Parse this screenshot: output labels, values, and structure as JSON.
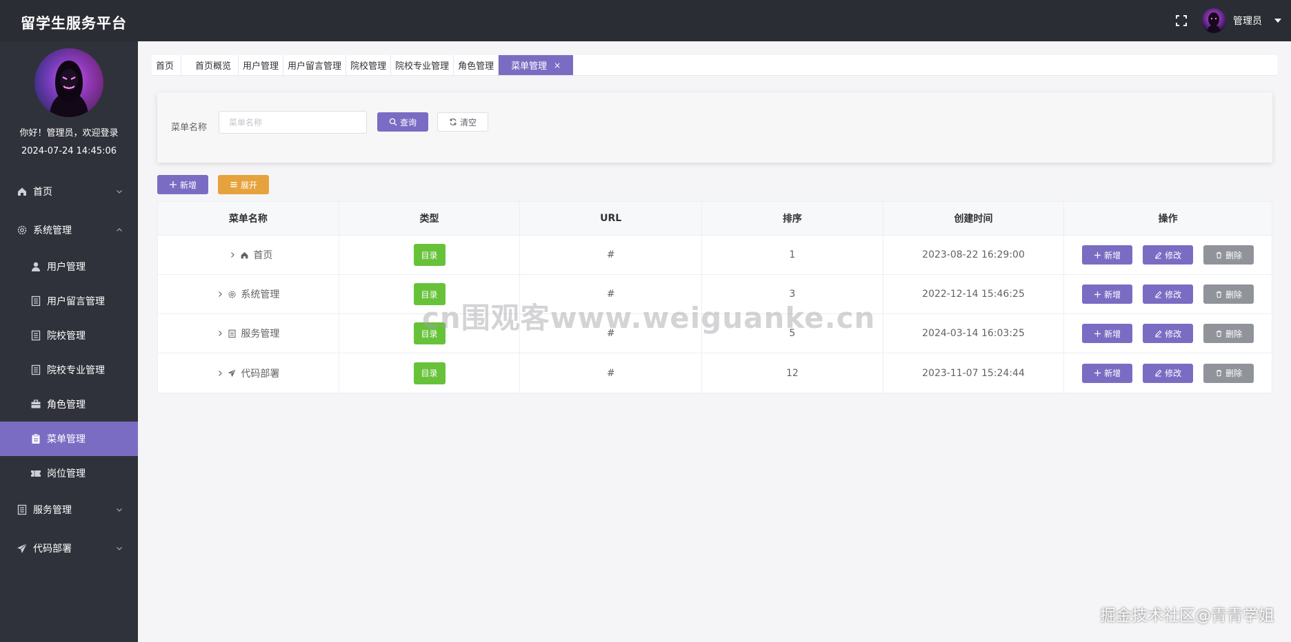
{
  "header": {
    "title": "留学生服务平台",
    "user_name": "管理员",
    "bg": "#2b2d34"
  },
  "sidebar": {
    "welcome": "你好！管理员，欢迎登录",
    "login_time": "2024-07-24 14:45:06",
    "items": [
      {
        "label": "首页",
        "icon": "home-icon"
      },
      {
        "label": "系统管理",
        "icon": "gear-icon",
        "expanded": true
      },
      {
        "label": "用户管理",
        "icon": "user-icon"
      },
      {
        "label": "用户留言管理",
        "icon": "document-icon"
      },
      {
        "label": "院校管理",
        "icon": "document-icon"
      },
      {
        "label": "院校专业管理",
        "icon": "document-icon"
      },
      {
        "label": "角色管理",
        "icon": "briefcase-icon"
      },
      {
        "label": "菜单管理",
        "icon": "clipboard-icon",
        "active": true
      },
      {
        "label": "岗位管理",
        "icon": "ticket-icon"
      },
      {
        "label": "服务管理",
        "icon": "document-icon"
      },
      {
        "label": "代码部署",
        "icon": "send-icon"
      }
    ],
    "active_color": "#7b6cc3"
  },
  "tabs": [
    {
      "label": "首页"
    },
    {
      "label": "首页概览"
    },
    {
      "label": "用户管理"
    },
    {
      "label": "用户留言管理"
    },
    {
      "label": "院校管理"
    },
    {
      "label": "院校专业管理"
    },
    {
      "label": "角色管理"
    },
    {
      "label": "菜单管理",
      "active": true,
      "close": "×"
    }
  ],
  "search": {
    "label": "菜单名称",
    "placeholder": "菜单名称",
    "value": "",
    "query_label": "查询",
    "clear_label": "清空"
  },
  "toolbar": {
    "add_label": "新增",
    "expand_label": "展开"
  },
  "table": {
    "columns": [
      "菜单名称",
      "类型",
      "URL",
      "排序",
      "创建时间",
      "操作"
    ],
    "rows": [
      {
        "name": "首页",
        "icon": "home-icon",
        "type": "目录",
        "url": "#",
        "order": "1",
        "created": "2023-08-22 16:29:00"
      },
      {
        "name": "系统管理",
        "icon": "gear-icon",
        "type": "目录",
        "url": "#",
        "order": "3",
        "created": "2022-12-14 15:46:25"
      },
      {
        "name": "服务管理",
        "icon": "document-icon",
        "type": "目录",
        "url": "#",
        "order": "5",
        "created": "2024-03-14 16:03:25"
      },
      {
        "name": "代码部署",
        "icon": "send-icon",
        "type": "目录",
        "url": "#",
        "order": "12",
        "created": "2023-11-07 15:24:44"
      }
    ],
    "actions": {
      "add": "新增",
      "edit": "修改",
      "delete": "删除"
    }
  },
  "colors": {
    "primary": "#7b6cc3",
    "success": "#67c23a",
    "warning": "#e6a23c",
    "info": "#909399"
  },
  "watermark": "cn围观客www.weiguanke.cn",
  "corner_mark": "掘金技术社区@青青学姐"
}
